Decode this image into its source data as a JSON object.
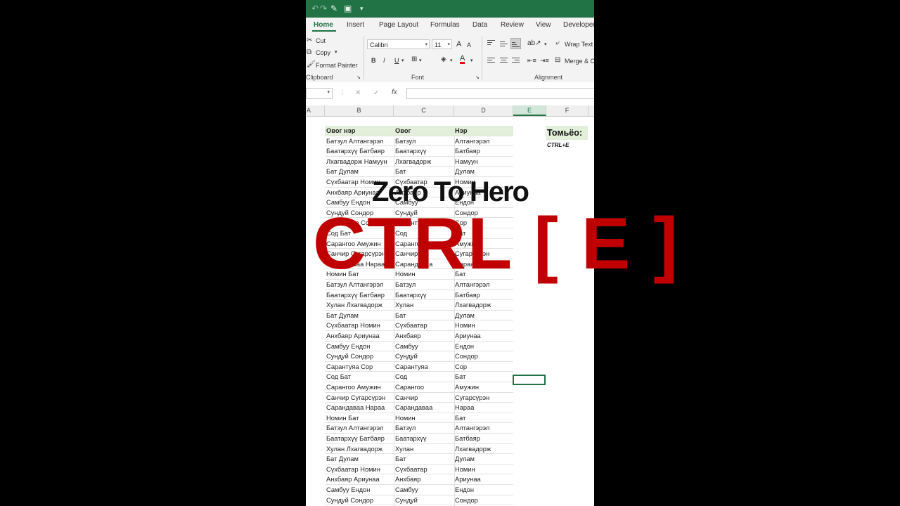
{
  "quick_access": {
    "undo_icon": "undo-icon",
    "redo_icon": "redo-icon",
    "brush_icon": "brush-icon",
    "save_icon": "save-icon",
    "more": "▾"
  },
  "tabs": [
    {
      "label": "Home",
      "active": true
    },
    {
      "label": "Insert"
    },
    {
      "label": "Page Layout"
    },
    {
      "label": "Formulas"
    },
    {
      "label": "Data"
    },
    {
      "label": "Review"
    },
    {
      "label": "View"
    },
    {
      "label": "Developer"
    }
  ],
  "clipboard": {
    "cut": "Cut",
    "copy": "Copy",
    "format_painter": "Format Painter",
    "group": "Clipboard"
  },
  "font": {
    "name": "Calibri",
    "size": "11",
    "group": "Font",
    "bold": "B",
    "italic": "I",
    "underline": "U",
    "grow": "A",
    "shrink": "A",
    "color_letter": "A"
  },
  "alignment": {
    "wrap_text": "Wrap Text",
    "merge": "Merge & C",
    "group": "Alignment"
  },
  "formula_bar": {
    "cancel": "✕",
    "enter": "✓",
    "fx": "fx"
  },
  "columns": [
    "A",
    "B",
    "C",
    "D",
    "E",
    "F"
  ],
  "table": {
    "headers": [
      "Овог нэр",
      "Овог",
      "Нэр"
    ],
    "rows": [
      [
        "Батзул Алтангэрэл",
        "Батзул",
        "Алтангэрэл"
      ],
      [
        "Баатархүү Батбаяр",
        "Баатархүү",
        "Батбаяр"
      ],
      [
        "Лхагвадорж Намуун",
        "Лхагвадорж",
        "Намуун"
      ],
      [
        "Бат Дулам",
        "Бат",
        "Дулам"
      ],
      [
        "Сүхбаатар Номин",
        "Сүхбаатар",
        "Номин"
      ],
      [
        "Анхбаяр Ариунаа",
        "Анхбаяр",
        "Ариунаа"
      ],
      [
        "Самбуу Ендон",
        "Самбуу",
        "Ендон"
      ],
      [
        "Сундуй Сондор",
        "Сундуй",
        "Сондор"
      ],
      [
        "Сарантуяа Сор",
        "Сарантуяа",
        "Сор"
      ],
      [
        "Сод Бат",
        "Сод",
        "Бат"
      ],
      [
        "Сарангоо Амужин",
        "Сарангоо",
        "Амужин"
      ],
      [
        "Санчир Сугарсүрэн",
        "Санчир",
        "Сугарсүрэн"
      ],
      [
        "Сарандаваа Нараа",
        "Сарандаваа",
        "Нараа"
      ],
      [
        "Номин Бат",
        "Номин",
        "Бат"
      ],
      [
        "Батзул Алтангэрэл",
        "Батзул",
        "Алтангэрэл"
      ],
      [
        "Баатархүү Батбаяр",
        "Баатархүү",
        "Батбаяр"
      ],
      [
        "Хулан Лхагвадорж",
        "Хулан",
        "Лхагвадорж"
      ],
      [
        "Бат Дулам",
        "Бат",
        "Дулам"
      ],
      [
        "Сүхбаатар Номин",
        "Сүхбаатар",
        "Номин"
      ],
      [
        "Анхбаяр Ариунаа",
        "Анхбаяр",
        "Ариунаа"
      ],
      [
        "Самбуу Ендон",
        "Самбуу",
        "Ендон"
      ],
      [
        "Сундуй Сондор",
        "Сундуй",
        "Сондор"
      ],
      [
        "Сарантуяа Сор",
        "Сарантуяа",
        "Сор"
      ],
      [
        "Сод Бат",
        "Сод",
        "Бат"
      ],
      [
        "Сарангоо Амужин",
        "Сарангоо",
        "Амужин"
      ],
      [
        "Санчир Сугарсүрэн",
        "Санчир",
        "Сугарсүрэн"
      ],
      [
        "Сарандаваа Нараа",
        "Сарандаваа",
        "Нараа"
      ],
      [
        "Номин Бат",
        "Номин",
        "Бат"
      ],
      [
        "Батзул Алтангэрэл",
        "Батзул",
        "Алтангэрэл"
      ],
      [
        "Баатархүү Батбаяр",
        "Баатархүү",
        "Батбаяр"
      ],
      [
        "Хулан Лхагвадорж",
        "Хулан",
        "Лхагвадорж"
      ],
      [
        "Бат Дулам",
        "Бат",
        "Дулам"
      ],
      [
        "Сүхбаатар Номин",
        "Сүхбаатар",
        "Номин"
      ],
      [
        "Анхбаяр Ариунаа",
        "Анхбаяр",
        "Ариунаа"
      ],
      [
        "Самбуу Ендон",
        "Самбуу",
        "Ендон"
      ],
      [
        "Сундуй Сондор",
        "Сундуй",
        "Сондор"
      ]
    ]
  },
  "tip": {
    "title": "Томьёо:",
    "shortcut": "CTRL+E"
  },
  "overlay": {
    "line1": "Zero To Hero",
    "line2": "CTRL [ E ]"
  },
  "colors": {
    "excel_green": "#217346",
    "header_fill": "#e2efda",
    "overlay_red": "#c00000"
  }
}
